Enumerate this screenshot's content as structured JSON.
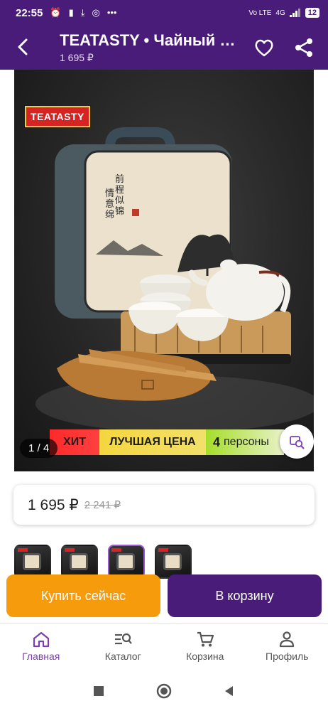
{
  "status_bar": {
    "time": "22:55",
    "network": "4G",
    "volte": "Vo LTE",
    "battery": "12"
  },
  "header": {
    "title": "TEATASTY • Чайный набор",
    "subtitle": "1 695 ₽",
    "icons": [
      "back-arrow-icon",
      "heart-icon",
      "share-icon"
    ]
  },
  "product_photo": {
    "brand_label": "TEATASTY",
    "counter": "1 / 4",
    "badges": {
      "hit": "ХИТ",
      "best_price": "ЛУЧШАЯ ЦЕНА",
      "persons_number": "4",
      "persons_label": "персоны"
    }
  },
  "price": {
    "current": "1 695 ₽",
    "old": "2 241 ₽"
  },
  "thumbnails": {
    "count": 4,
    "selected_index": 2
  },
  "actions": {
    "buy_now": "Купить сейчас",
    "add_to_cart": "В корзину"
  },
  "tabs": [
    {
      "label": "Главная",
      "icon": "home-icon",
      "active": true
    },
    {
      "label": "Каталог",
      "icon": "catalog-search-icon",
      "active": false
    },
    {
      "label": "Корзина",
      "icon": "cart-icon",
      "active": false
    },
    {
      "label": "Профиль",
      "icon": "profile-icon",
      "active": false
    }
  ],
  "colors": {
    "brand_purple": "#4a1c7a",
    "buy_orange": "#f59b0c",
    "active_tab": "#7b3fb0"
  }
}
